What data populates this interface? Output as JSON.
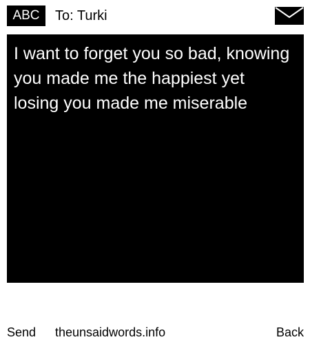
{
  "header": {
    "mode": "ABC",
    "to": "To: Turki",
    "icon": "envelope-icon"
  },
  "message": {
    "text": "I want to forget you so bad, knowing you made me the happiest yet losing you made me miserable"
  },
  "footer": {
    "send_label": "Send",
    "site": "theunsaidwords.info",
    "back_label": "Back"
  }
}
